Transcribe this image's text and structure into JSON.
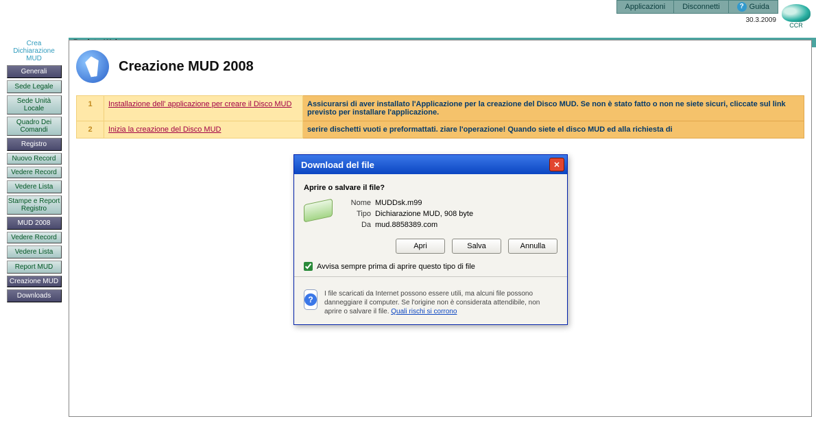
{
  "topbar": {
    "apps": "Applicazioni",
    "disconnect": "Disconnetti",
    "guide": "Guida",
    "date": "30.3.2009",
    "ccr": "CCR"
  },
  "band_title": "RegistroWeb",
  "sidebar": {
    "note1": "Crea",
    "note2": "Dichiarazione",
    "note3": "MUD",
    "items": [
      {
        "label": "Generali",
        "dark": true
      },
      {
        "label": "Sede Legale",
        "dark": false
      },
      {
        "label": "Sede Unità Locale",
        "dark": false,
        "tall": true
      },
      {
        "label": "Quadro Dei Comandi",
        "dark": false,
        "tall": true
      },
      {
        "label": "Registro",
        "dark": true
      },
      {
        "label": "Nuovo Record",
        "dark": false,
        "tall": true
      },
      {
        "label": "Vedere Record",
        "dark": false,
        "tall": true
      },
      {
        "label": "Vedere Lista",
        "dark": false
      },
      {
        "label": "Stampe e Report Registro",
        "dark": false,
        "tall": true
      },
      {
        "label": "MUD 2008",
        "dark": true
      },
      {
        "label": "Vedere Record",
        "dark": false,
        "tall": true
      },
      {
        "label": "Vedere Lista",
        "dark": false
      },
      {
        "label": "Report MUD",
        "dark": false
      },
      {
        "label": "Creazione MUD",
        "dark": true,
        "tall": true
      },
      {
        "label": "Downloads",
        "dark": true
      }
    ]
  },
  "page": {
    "title": "Creazione MUD 2008",
    "steps": [
      {
        "num": "1",
        "link": "Installazione dell' applicazione per creare il Disco MUD",
        "desc": "Assicurarsi di aver installato l'Applicazione per la creazione del Disco MUD. Se non è stato fatto o non ne siete sicuri, cliccate sul link previsto per installare l'applicazione."
      },
      {
        "num": "2",
        "link": "Inizia la creazione del Disco MUD",
        "desc": "serire dischetti vuoti e preformattati. ziare l'operazione! Quando siete el disco MUD ed alla richiesta di"
      }
    ]
  },
  "dialog": {
    "title": "Download del file",
    "question": "Aprire o salvare il file?",
    "labels": {
      "name": "Nome",
      "type": "Tipo",
      "from": "Da"
    },
    "values": {
      "name": "MUDDsk.m99",
      "type": "Dichiarazione MUD, 908 byte",
      "from": "mud.8858389.com"
    },
    "actions": {
      "open": "Apri",
      "save": "Salva",
      "cancel": "Annulla"
    },
    "checkbox": "Avvisa sempre prima di aprire questo tipo di file",
    "foot_text": "I file scaricati da Internet possono essere utili, ma alcuni file possono danneggiare il computer. Se l'origine non è considerata attendibile, non aprire o salvare il file. ",
    "foot_link": "Quali rischi si corrono"
  }
}
